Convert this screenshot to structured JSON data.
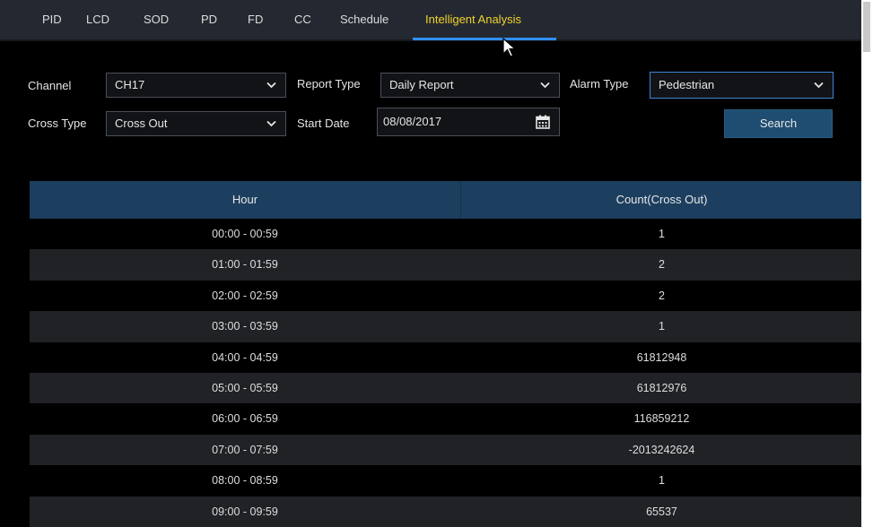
{
  "tabs": [
    {
      "label": "PID",
      "active": false
    },
    {
      "label": "LCD",
      "active": false
    },
    {
      "label": "SOD",
      "active": false
    },
    {
      "label": "PD",
      "active": false
    },
    {
      "label": "FD",
      "active": false
    },
    {
      "label": "CC",
      "active": false
    },
    {
      "label": "Schedule",
      "active": false
    },
    {
      "label": "Intelligent Analysis",
      "active": true
    }
  ],
  "filters": {
    "channel": {
      "label": "Channel",
      "value": "CH17"
    },
    "report_type": {
      "label": "Report Type",
      "value": "Daily Report"
    },
    "alarm_type": {
      "label": "Alarm Type",
      "value": "Pedestrian"
    },
    "cross_type": {
      "label": "Cross Type",
      "value": "Cross Out"
    },
    "start_date": {
      "label": "Start Date",
      "value": "08/08/2017"
    },
    "search_label": "Search"
  },
  "table": {
    "columns": [
      "Hour",
      "Count(Cross Out)"
    ],
    "rows": [
      {
        "hour": "00:00 - 00:59",
        "count": "1"
      },
      {
        "hour": "01:00 - 01:59",
        "count": "2"
      },
      {
        "hour": "02:00 - 02:59",
        "count": "2"
      },
      {
        "hour": "03:00 - 03:59",
        "count": "1"
      },
      {
        "hour": "04:00 - 04:59",
        "count": "61812948"
      },
      {
        "hour": "05:00 - 05:59",
        "count": "61812976"
      },
      {
        "hour": "06:00 - 06:59",
        "count": "116859212"
      },
      {
        "hour": "07:00 - 07:59",
        "count": "-2013242624"
      },
      {
        "hour": "08:00 - 08:59",
        "count": "1"
      },
      {
        "hour": "09:00 - 09:59",
        "count": "65537"
      }
    ]
  },
  "colors": {
    "active_tab": "#f2d22c",
    "accent_underline": "#2f8ef2",
    "header_bg": "#1d3f5f",
    "button_bg": "#1f4d71"
  },
  "icons": {
    "dropdown": "chevron-down-icon",
    "calendar": "calendar-icon",
    "pointer": "mouse-cursor-icon"
  }
}
